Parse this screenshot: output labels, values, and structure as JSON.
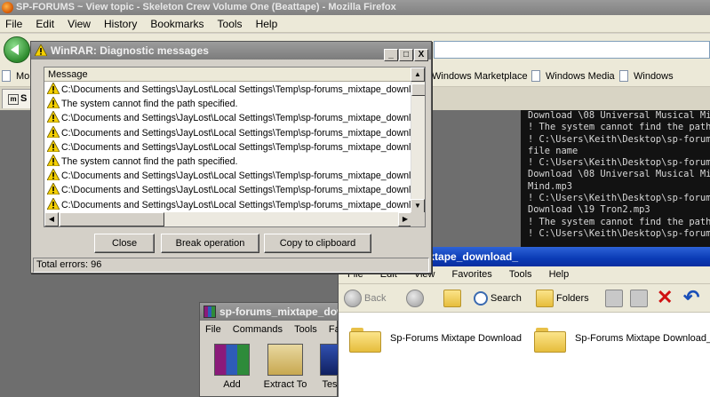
{
  "firefox": {
    "title": "SP-FORUMS ~ View topic - Skeleton Crew Volume One (Beattape) - Mozilla Firefox",
    "menu": [
      "File",
      "Edit",
      "View",
      "History",
      "Bookmarks",
      "Tools",
      "Help"
    ],
    "bookmarks": [
      "Mo",
      "Windows Marketplace",
      "Windows Media",
      "Windows"
    ],
    "tab_label": "S",
    "tab_favicon": "m"
  },
  "console": {
    "lines": [
      "Download \\08 Universal Musical Mind",
      "! The system cannot find the path spe",
      "! C:\\Users\\Keith\\Desktop\\sp-forums_",
      "file name",
      "! C:\\Users\\Keith\\Desktop\\sp-forums_",
      "Download \\08 Universal Musical Mind",
      "Mind.mp3",
      "! C:\\Users\\Keith\\Desktop\\sp-forums_",
      "Download \\19 Tron2.mp3",
      "! The system cannot find the path spe",
      "! C:\\Users\\Keith\\Desktop\\sp-forums_"
    ]
  },
  "diagnostic": {
    "title": "WinRAR: Diagnostic messages",
    "column_header": "Message",
    "messages": [
      "C:\\Documents and Settings\\JayLost\\Local Settings\\Temp\\sp-forums_mixtape_downlo",
      "The system cannot find the path specified.",
      "C:\\Documents and Settings\\JayLost\\Local Settings\\Temp\\sp-forums_mixtape_downlo",
      "C:\\Documents and Settings\\JayLost\\Local Settings\\Temp\\sp-forums_mixtape_downlo",
      "C:\\Documents and Settings\\JayLost\\Local Settings\\Temp\\sp-forums_mixtape_downlo",
      "The system cannot find the path specified.",
      "C:\\Documents and Settings\\JayLost\\Local Settings\\Temp\\sp-forums_mixtape_downlo",
      "C:\\Documents and Settings\\JayLost\\Local Settings\\Temp\\sp-forums_mixtape_downlo",
      "C:\\Documents and Settings\\JayLost\\Local Settings\\Temp\\sp-forums_mixtape_downlo"
    ],
    "buttons": {
      "close": "Close",
      "break": "Break operation",
      "copy": "Copy to clipboard"
    },
    "status": "Total errors: 96",
    "title_buttons": {
      "minimize": "_",
      "maximize": "□",
      "close": "X"
    }
  },
  "explorer": {
    "title": "sp-forums_mixtape_download_",
    "menu": [
      "File",
      "Edit",
      "View",
      "Favorites",
      "Tools",
      "Help"
    ],
    "toolbar": {
      "back": "Back",
      "search": "Search",
      "folders": "Folders"
    },
    "folders": [
      "Sp-Forums Mixtape Download",
      "Sp-Forums Mixtape Download_"
    ]
  },
  "winrar": {
    "title": "sp-forums_mixtape_dow",
    "menu": [
      "File",
      "Commands",
      "Tools",
      "Favo"
    ],
    "tools": [
      "Add",
      "Extract To",
      "Tes"
    ]
  },
  "colors": {
    "explorer_title": "#0a3bb5",
    "inactive_title": "#8a8a8a",
    "warning": "#f5d000",
    "delete_red": "#d01010"
  }
}
